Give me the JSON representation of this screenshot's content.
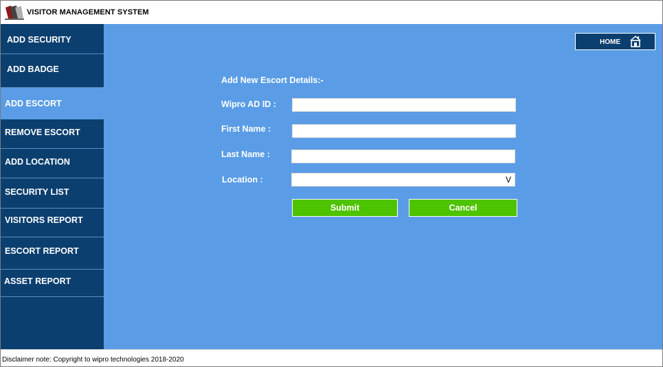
{
  "app": {
    "title": "VISITOR MANAGEMENT SYSTEM"
  },
  "sidebar": {
    "items": [
      {
        "label": "ADD SECURITY",
        "active": false
      },
      {
        "label": "ADD BADGE",
        "active": false
      },
      {
        "label": "ADD ESCORT",
        "active": true
      },
      {
        "label": "REMOVE ESCORT",
        "active": false
      },
      {
        "label": "ADD LOCATION",
        "active": false
      },
      {
        "label": "SECURITY LIST",
        "active": false
      },
      {
        "label": "VISITORS REPORT",
        "active": false
      },
      {
        "label": "ESCORT REPORT",
        "active": false
      },
      {
        "label": "ASSET REPORT",
        "active": false
      }
    ]
  },
  "header": {
    "home_label": "HOME",
    "home_icon": "home-icon"
  },
  "form": {
    "title": "Add New Escort Details:-",
    "fields": {
      "ad_id_label": "Wipro AD ID :",
      "ad_id_value": "",
      "first_name_label": "First Name :",
      "first_name_value": "",
      "last_name_label": "Last Name :",
      "last_name_value": "",
      "location_label": "Location :",
      "location_value": ""
    },
    "submit_label": "Submit",
    "cancel_label": "Cancel"
  },
  "footer": {
    "disclaimer": "Disclaimer note: Copyright to wipro technologies 2018-2020"
  },
  "colors": {
    "sidebar_bg": "#0b3f6f",
    "main_bg": "#5a9de6",
    "button_green": "#4ec300"
  }
}
